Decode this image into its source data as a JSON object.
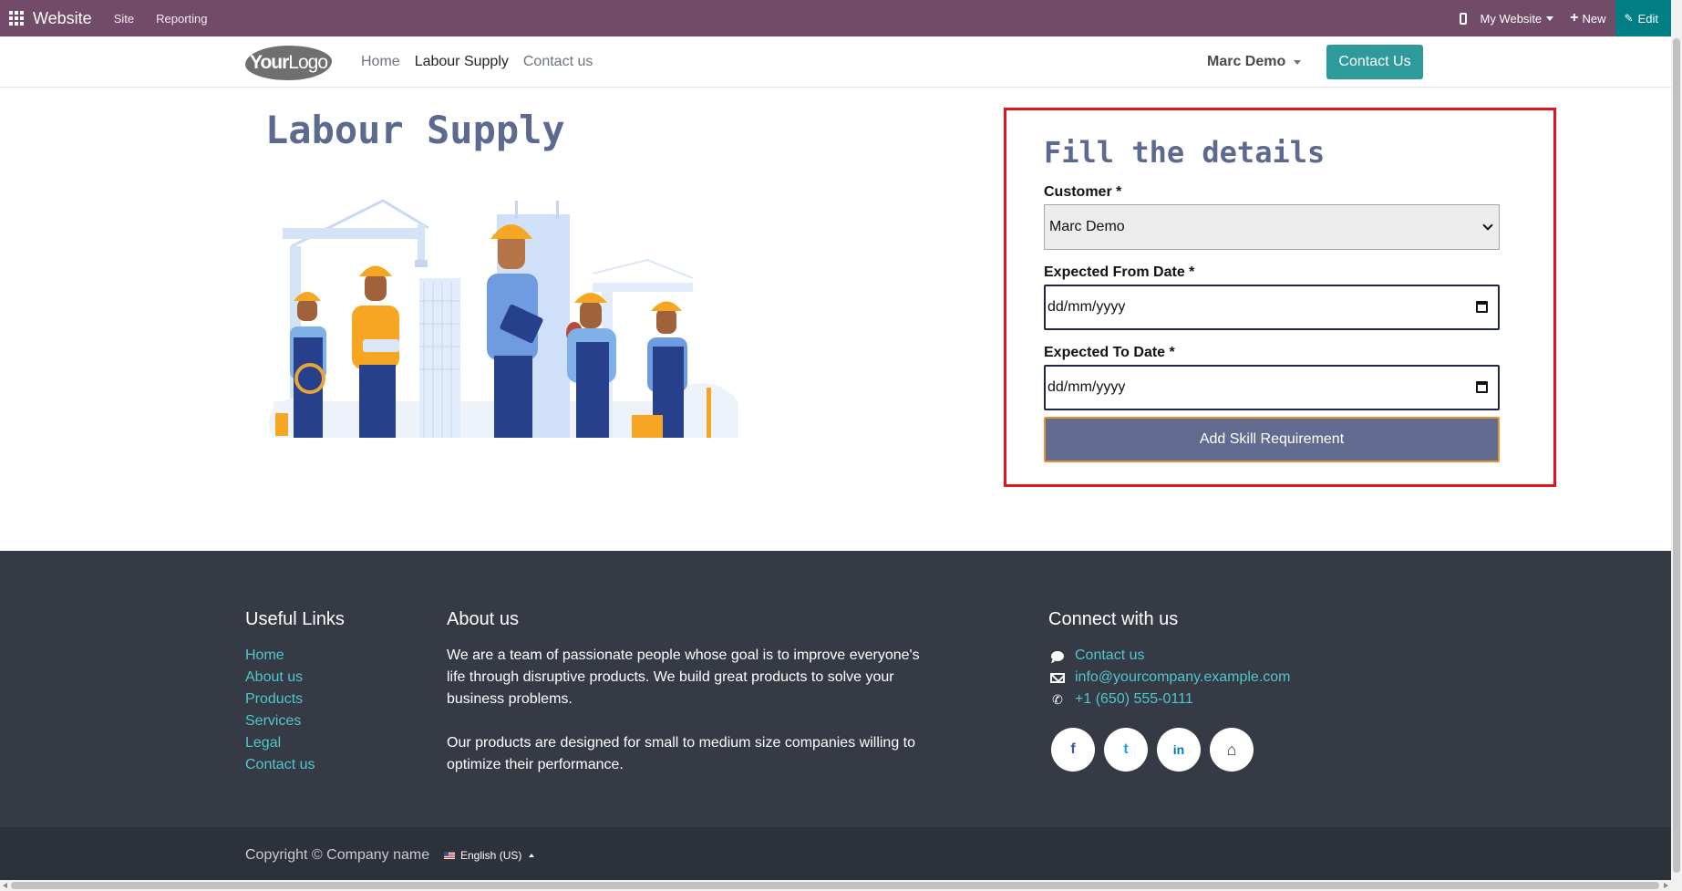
{
  "topbar": {
    "brand": "Website",
    "menus": [
      "Site",
      "Reporting"
    ],
    "site_selector": "My Website",
    "new_label": "New",
    "edit_label": "Edit",
    "bar_color": "#714b67",
    "edit_color": "#017e84"
  },
  "header": {
    "logo_bold": "Your",
    "logo_light": "Logo",
    "nav": [
      "Home",
      "Labour Supply",
      "Contact us"
    ],
    "active_nav": "Labour Supply",
    "user": "Marc Demo",
    "contact_button": "Contact Us"
  },
  "main": {
    "title": "Labour Supply",
    "form": {
      "title": "Fill the details",
      "customer_label": "Customer *",
      "customer_value": "Marc Demo",
      "from_label": "Expected From Date *",
      "from_placeholder": "dd/mm/yyyy",
      "to_label": "Expected To Date *",
      "to_placeholder": "dd/mm/yyyy",
      "submit_label": "Add Skill Requirement",
      "highlight_color": "#e0151c"
    }
  },
  "footer": {
    "useful_links_title": "Useful Links",
    "useful_links": [
      "Home",
      "About us",
      "Products",
      "Services",
      "Legal",
      "Contact us"
    ],
    "about_title": "About us",
    "about_text_1": "We are a team of passionate people whose goal is to improve everyone's life through disruptive products. We build great products to solve your business problems.",
    "about_text_2": "Our products are designed for small to medium size companies willing to optimize their performance.",
    "connect_title": "Connect with us",
    "contact_link": "Contact us",
    "email": "info@yourcompany.example.com",
    "phone": "+1 (650) 555-0111",
    "social": [
      {
        "icon": "facebook-icon",
        "glyph": "f",
        "color": "#3b5998"
      },
      {
        "icon": "twitter-icon",
        "glyph": "t",
        "color": "#1da1f2"
      },
      {
        "icon": "linkedin-icon",
        "glyph": "in",
        "color": "#0077b5"
      },
      {
        "icon": "home-icon",
        "glyph": "⌂",
        "color": "#353a44"
      }
    ],
    "copyright": "Copyright © Company name",
    "language": "English (US)"
  }
}
